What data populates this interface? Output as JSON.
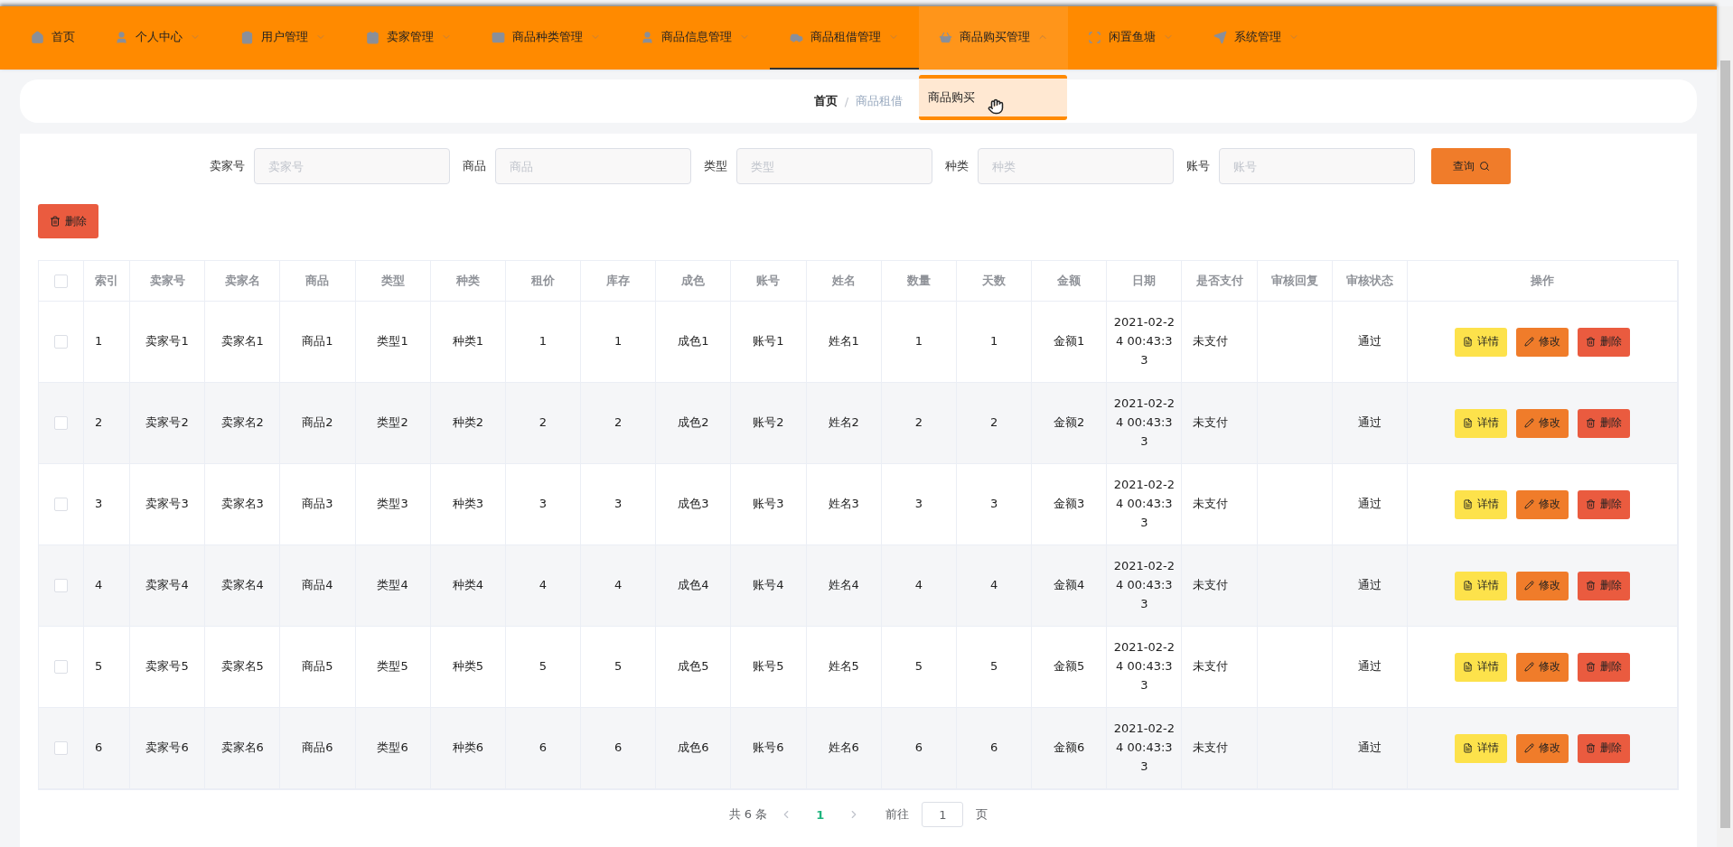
{
  "nav": {
    "items": [
      {
        "label": "首页",
        "dropdown": false,
        "selected": false,
        "expanded": false
      },
      {
        "label": "个人中心",
        "dropdown": true,
        "selected": false,
        "expanded": false
      },
      {
        "label": "用户管理",
        "dropdown": true,
        "selected": false,
        "expanded": false
      },
      {
        "label": "卖家管理",
        "dropdown": true,
        "selected": false,
        "expanded": false
      },
      {
        "label": "商品种类管理",
        "dropdown": true,
        "selected": false,
        "expanded": false
      },
      {
        "label": "商品信息管理",
        "dropdown": true,
        "selected": false,
        "expanded": false
      },
      {
        "label": "商品租借管理",
        "dropdown": true,
        "selected": true,
        "expanded": false
      },
      {
        "label": "商品购买管理",
        "dropdown": true,
        "selected": false,
        "expanded": true,
        "menu": [
          "商品购买"
        ]
      },
      {
        "label": "闲置鱼塘",
        "dropdown": true,
        "selected": false,
        "expanded": false
      },
      {
        "label": "系统管理",
        "dropdown": true,
        "selected": false,
        "expanded": false
      }
    ]
  },
  "breadcrumb": {
    "items": [
      "首页",
      "商品租借"
    ],
    "separator": "/"
  },
  "search": {
    "fields": [
      {
        "label": "卖家号",
        "placeholder": "卖家号"
      },
      {
        "label": "商品",
        "placeholder": "商品"
      },
      {
        "label": "类型",
        "placeholder": "类型"
      },
      {
        "label": "种类",
        "placeholder": "种类"
      },
      {
        "label": "账号",
        "placeholder": "账号"
      }
    ],
    "button": "查询"
  },
  "bulk_delete": "删除",
  "table": {
    "columns": [
      "索引",
      "卖家号",
      "卖家名",
      "商品",
      "类型",
      "种类",
      "租价",
      "库存",
      "成色",
      "账号",
      "姓名",
      "数量",
      "天数",
      "金额",
      "日期",
      "是否支付",
      "审核回复",
      "审核状态",
      "操作"
    ],
    "select_all_checked": false,
    "rows": [
      {
        "checked": false,
        "actions": [
          {
            "kind": "detail",
            "label": "详情"
          },
          {
            "kind": "edit",
            "label": "修改"
          },
          {
            "kind": "delete",
            "label": "删除"
          }
        ],
        "cells": [
          "1",
          "卖家号1",
          "卖家名1",
          "商品1",
          "类型1",
          "种类1",
          "1",
          "1",
          "成色1",
          "账号1",
          "姓名1",
          "1",
          "1",
          "金额1",
          "2021-02-24 00:43:33",
          "未支付",
          "",
          "通过"
        ]
      },
      {
        "checked": false,
        "actions": [
          {
            "kind": "detail",
            "label": "详情"
          },
          {
            "kind": "edit",
            "label": "修改"
          },
          {
            "kind": "delete",
            "label": "删除"
          }
        ],
        "cells": [
          "2",
          "卖家号2",
          "卖家名2",
          "商品2",
          "类型2",
          "种类2",
          "2",
          "2",
          "成色2",
          "账号2",
          "姓名2",
          "2",
          "2",
          "金额2",
          "2021-02-24 00:43:33",
          "未支付",
          "",
          "通过"
        ]
      },
      {
        "checked": false,
        "actions": [
          {
            "kind": "detail",
            "label": "详情"
          },
          {
            "kind": "edit",
            "label": "修改"
          },
          {
            "kind": "delete",
            "label": "删除"
          }
        ],
        "cells": [
          "3",
          "卖家号3",
          "卖家名3",
          "商品3",
          "类型3",
          "种类3",
          "3",
          "3",
          "成色3",
          "账号3",
          "姓名3",
          "3",
          "3",
          "金额3",
          "2021-02-24 00:43:33",
          "未支付",
          "",
          "通过"
        ]
      },
      {
        "checked": false,
        "actions": [
          {
            "kind": "detail",
            "label": "详情"
          },
          {
            "kind": "edit",
            "label": "修改"
          },
          {
            "kind": "delete",
            "label": "删除"
          }
        ],
        "cells": [
          "4",
          "卖家号4",
          "卖家名4",
          "商品4",
          "类型4",
          "种类4",
          "4",
          "4",
          "成色4",
          "账号4",
          "姓名4",
          "4",
          "4",
          "金额4",
          "2021-02-24 00:43:33",
          "未支付",
          "",
          "通过"
        ]
      },
      {
        "checked": false,
        "actions": [
          {
            "kind": "detail",
            "label": "详情"
          },
          {
            "kind": "edit",
            "label": "修改"
          },
          {
            "kind": "delete",
            "label": "删除"
          }
        ],
        "cells": [
          "5",
          "卖家号5",
          "卖家名5",
          "商品5",
          "类型5",
          "种类5",
          "5",
          "5",
          "成色5",
          "账号5",
          "姓名5",
          "5",
          "5",
          "金额5",
          "2021-02-24 00:43:33",
          "未支付",
          "",
          "通过"
        ]
      },
      {
        "checked": false,
        "actions": [
          {
            "kind": "detail",
            "label": "详情"
          },
          {
            "kind": "edit",
            "label": "修改"
          },
          {
            "kind": "delete",
            "label": "删除"
          }
        ],
        "cells": [
          "6",
          "卖家号6",
          "卖家名6",
          "商品6",
          "类型6",
          "种类6",
          "6",
          "6",
          "成色6",
          "账号6",
          "姓名6",
          "6",
          "6",
          "金额6",
          "2021-02-24 00:43:33",
          "未支付",
          "",
          "通过"
        ]
      }
    ]
  },
  "pagination": {
    "total": "共 6 条",
    "pages": [
      {
        "label": "1",
        "selected": true
      }
    ],
    "goto": "前往",
    "page_value": "1",
    "page_unit": "页"
  }
}
